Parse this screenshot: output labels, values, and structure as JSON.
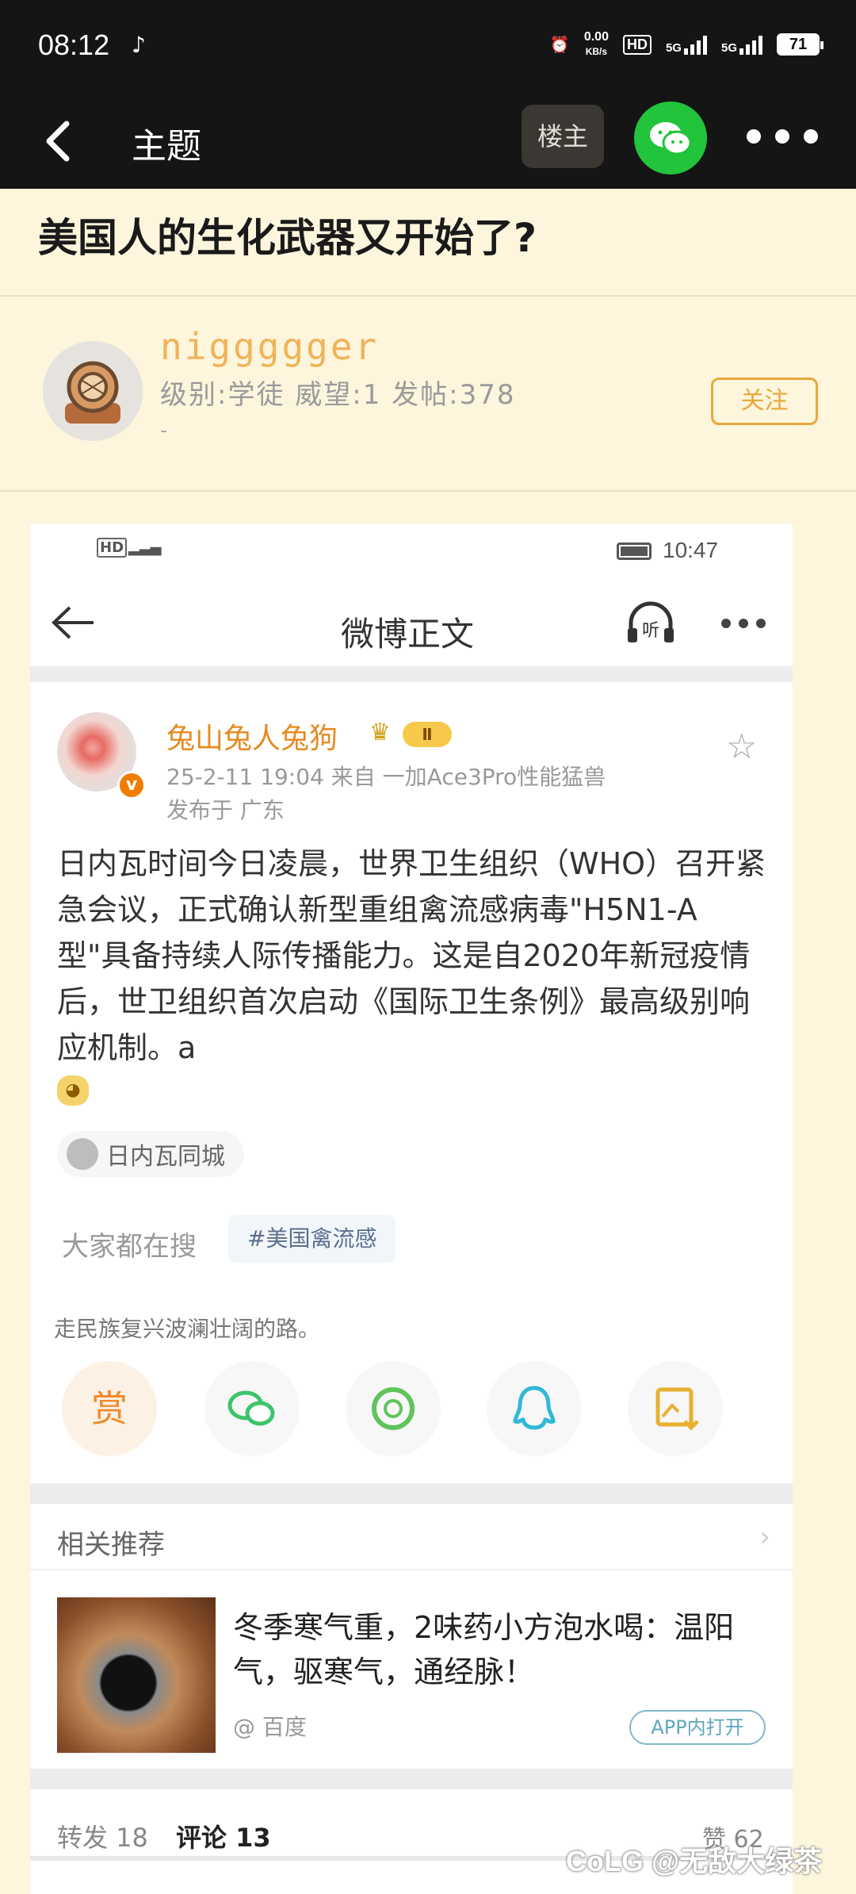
{
  "status_bar": {
    "time": "08:12",
    "net_speed_value": "0.00",
    "net_speed_unit": "KB/s",
    "hd_label": "HD",
    "sig1": "5G",
    "sig2": "5G",
    "battery": "71"
  },
  "nav": {
    "title": "主题",
    "louzhu_label": "楼主"
  },
  "topic": {
    "title": "美国人的生化武器又开始了?"
  },
  "user": {
    "name": "niggggger",
    "meta": "级别:学徒 威望:1 发帖:378",
    "dash": "-",
    "follow_label": "关注"
  },
  "shot": {
    "status_time": "10:47",
    "nav_title": "微博正文",
    "author": "兔山兔人兔狗",
    "level_badge": "Ⅱ",
    "date_line": "25-2-11 19:04  来自 一加Ace3Pro性能猛兽",
    "location": "发布于 广东",
    "body": "日内瓦时间今日凌晨，世界卫生组织（WHO）召开紧急会议，正式确认新型重组禽流感病毒\"H5N1-A型\"具备持续人际传播能力。这是自2020年新冠疫情后，世卫组织首次启动《国际卫生条例》最高级别响应机制。a",
    "tag": "日内瓦同城",
    "search_label": "大家都在搜",
    "search_chip": "#美国禽流感",
    "slogan": "走民族复兴波澜壮阔的路。",
    "reward_label": "赏",
    "related_title": "相关推荐",
    "rec_title": "冬季寒气重，2味药小方泡水喝：温阳气，驱寒气，通经脉！",
    "rec_source": "@ 百度",
    "rec_app": "APP内打开",
    "forward": "转发 18",
    "comment": "评论 13",
    "like": "赞 62"
  },
  "watermark": "CoLG @无敌大绿茶",
  "colors": {
    "accent": "#e7a93a",
    "username": "#f0b35a",
    "page_bg": "#fdf5dc",
    "wechat_green": "#22c43c"
  },
  "icons": [
    "back-arrow-icon",
    "wechat-icon",
    "more-icon",
    "listen-icon",
    "star-icon",
    "share-wechat-icon",
    "moments-icon",
    "qq-icon",
    "save-image-icon"
  ]
}
